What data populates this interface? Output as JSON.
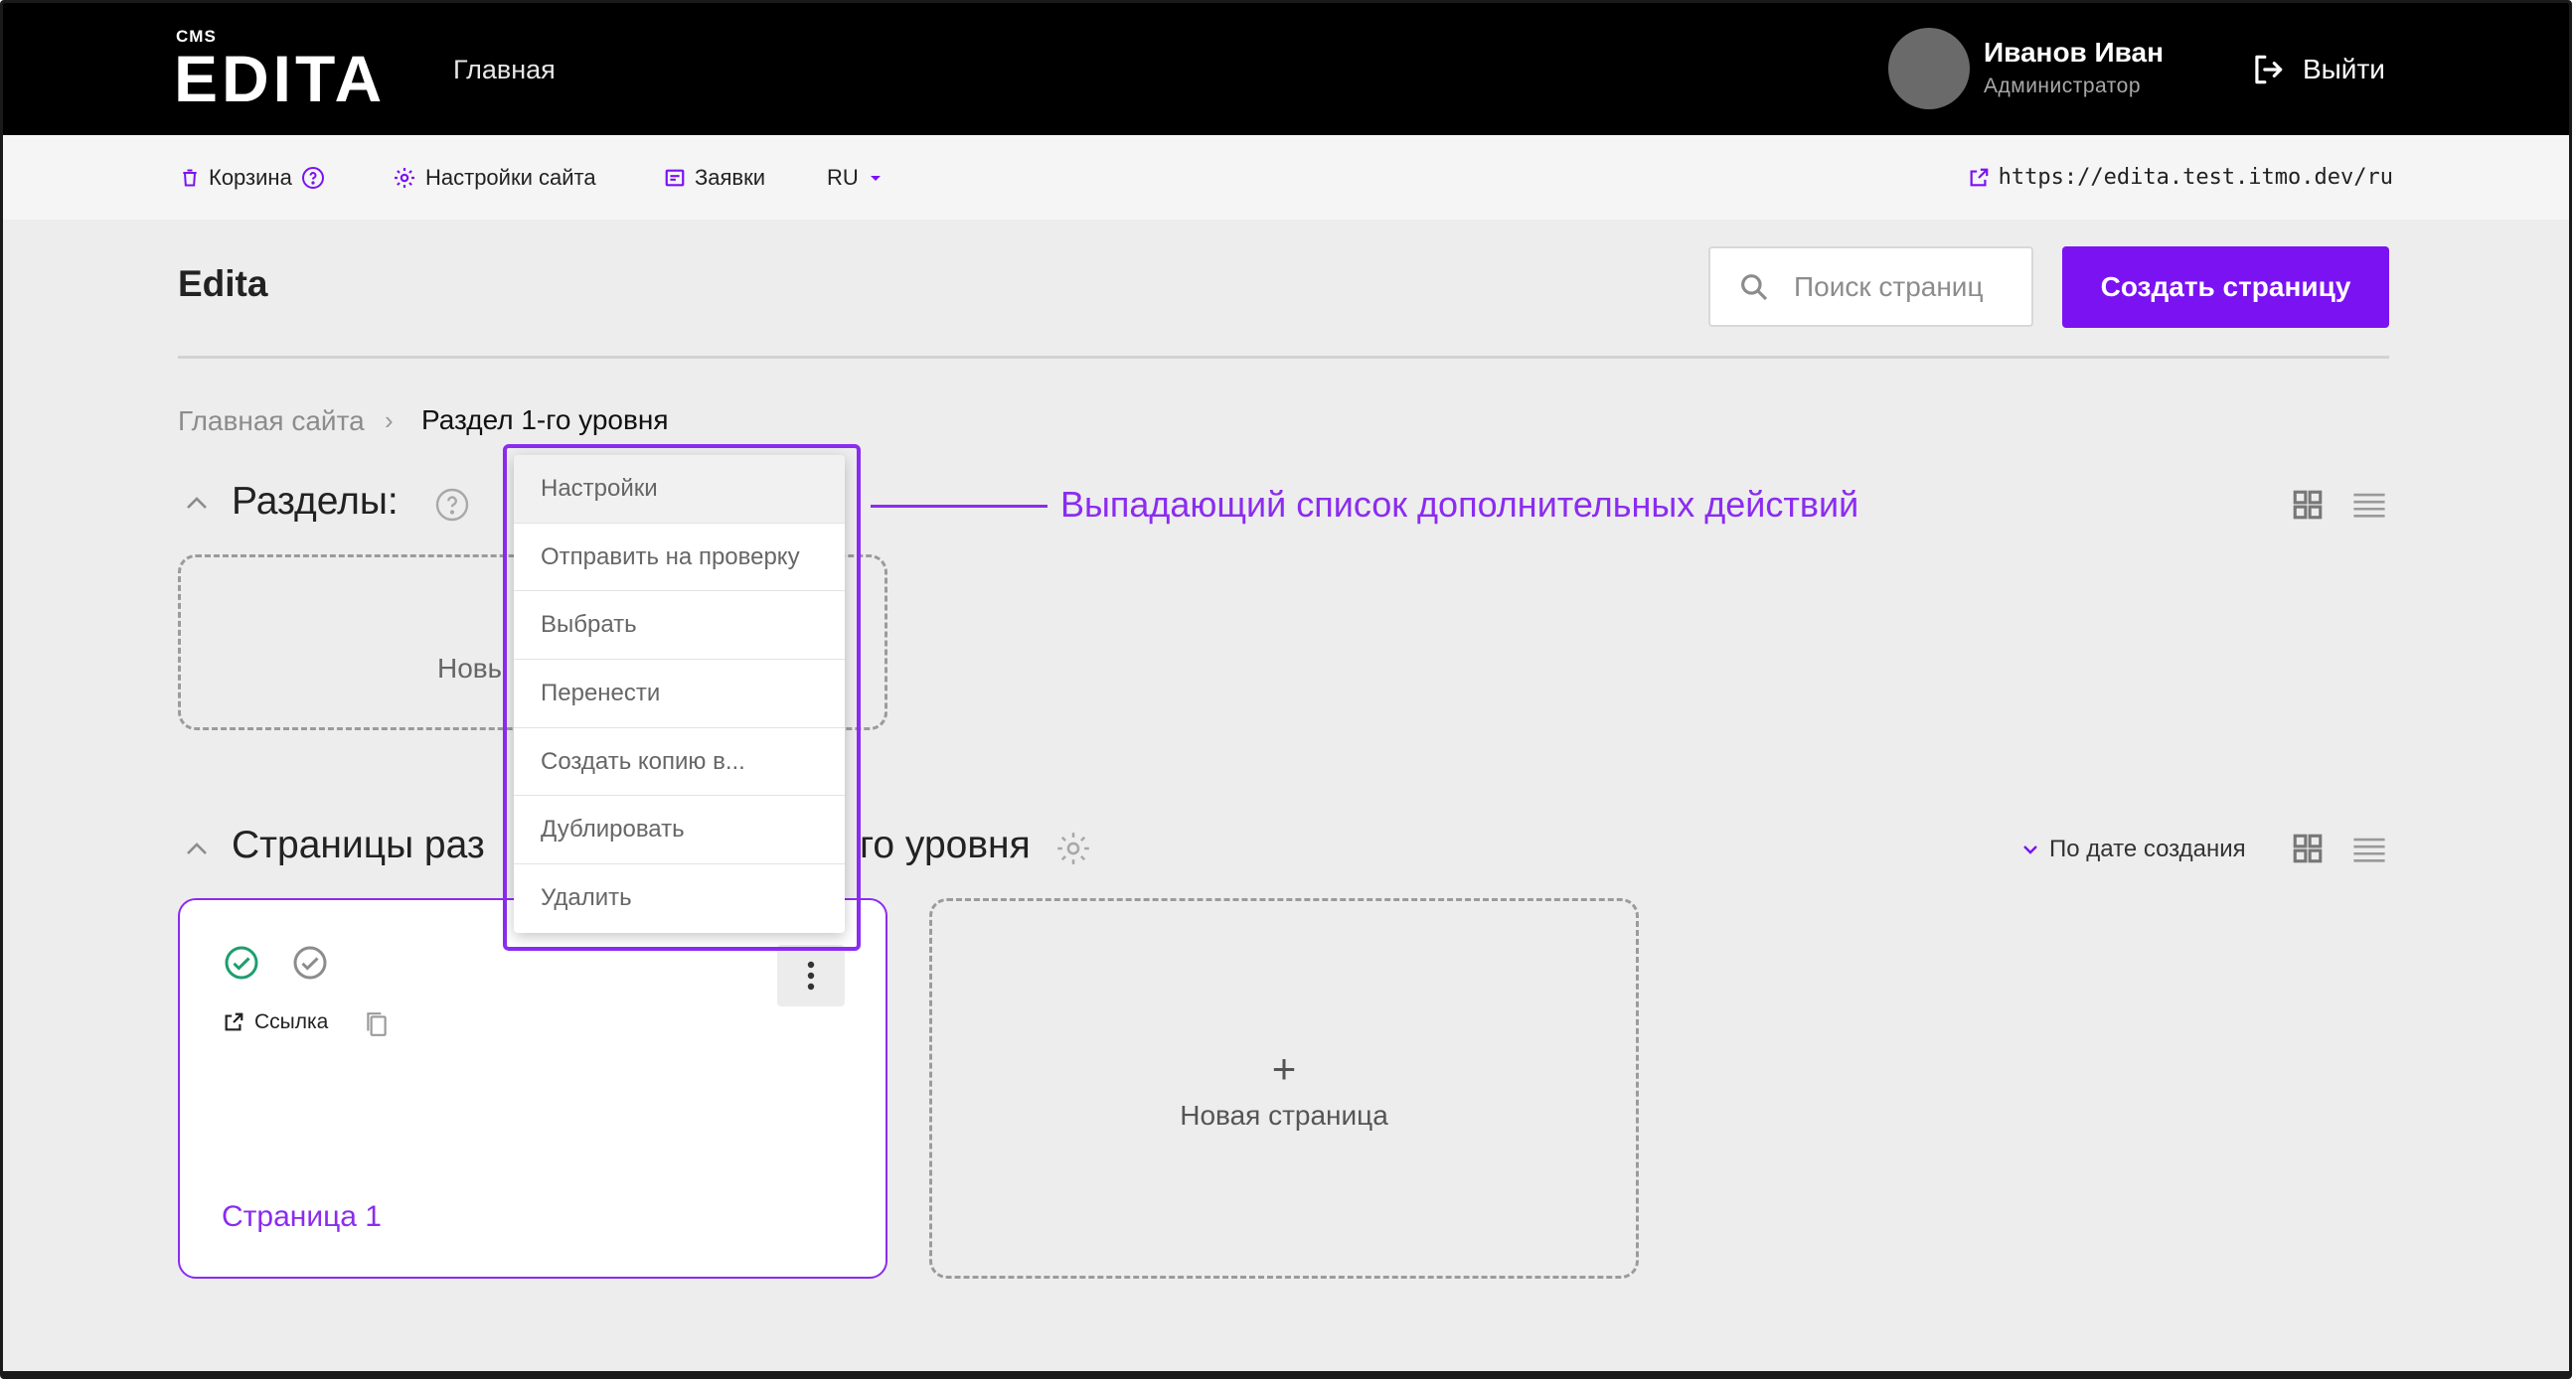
{
  "topbar": {
    "cms_label": "CMS",
    "logo": "EDITA",
    "nav_home": "Главная",
    "user_name": "Иванов Иван",
    "user_role": "Администратор",
    "logout_label": "Выйти"
  },
  "toolbar": {
    "trash_label": "Корзина",
    "settings_label": "Настройки сайта",
    "requests_label": "Заявки",
    "language": "RU",
    "site_url": "https://edita.test.itmo.dev/ru"
  },
  "header": {
    "site_title": "Edita",
    "search_placeholder": "Поиск страниц",
    "create_button": "Создать страницу"
  },
  "breadcrumb": {
    "root": "Главная сайта",
    "separator": "›",
    "current": "Раздел 1-го уровня"
  },
  "sections": {
    "title": "Разделы:",
    "new_card_label": "Новы"
  },
  "pages": {
    "title_left": "Страницы раз",
    "title_right": "го уровня",
    "sort_label": "По дате создания",
    "cards": [
      {
        "link_label": "Ссылка",
        "name": "Страница 1"
      }
    ],
    "new_page_plus": "+",
    "new_page_label": "Новая страница"
  },
  "dropdown": {
    "items": [
      "Настройки",
      "Отправить на проверку",
      "Выбрать",
      "Перенести",
      "Создать копию в...",
      "Дублировать",
      "Удалить"
    ]
  },
  "annotation": {
    "text": "Выпадающий список дополнительных действий"
  },
  "colors": {
    "accent": "#7b12f2",
    "annotation": "#8b2cf0",
    "status_green": "#1f9d6e",
    "topbar_bg": "#000000"
  }
}
